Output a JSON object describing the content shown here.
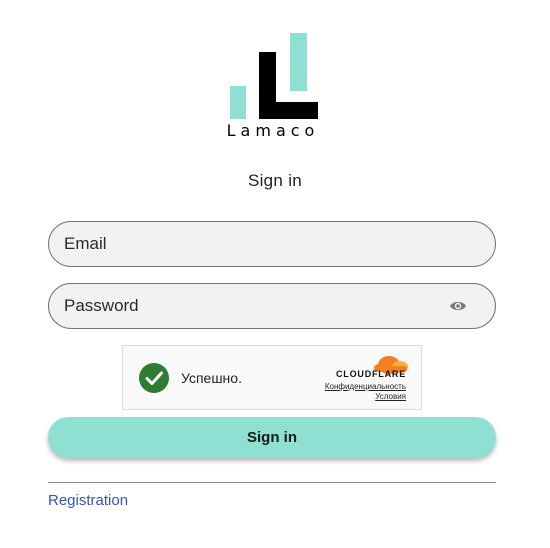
{
  "brand": {
    "name": "Lamaco",
    "colors": {
      "teal": "#8ee0d3",
      "black": "#000000"
    }
  },
  "heading": "Sign in",
  "form": {
    "email": {
      "placeholder": "Email",
      "value": ""
    },
    "password": {
      "placeholder": "Password",
      "value": "",
      "toggle_icon": "eye-icon"
    }
  },
  "captcha": {
    "status": "Успешно.",
    "provider": "CLOUDFLARE",
    "privacy_link": "Конфиденциальность",
    "terms_link": "Условия",
    "status_icon": "checkmark-circle-icon",
    "colors": {
      "success": "#2e7d32",
      "cloud": "#f38020"
    }
  },
  "submit": {
    "label": "Sign in"
  },
  "footer": {
    "registration_link": "Registration"
  }
}
